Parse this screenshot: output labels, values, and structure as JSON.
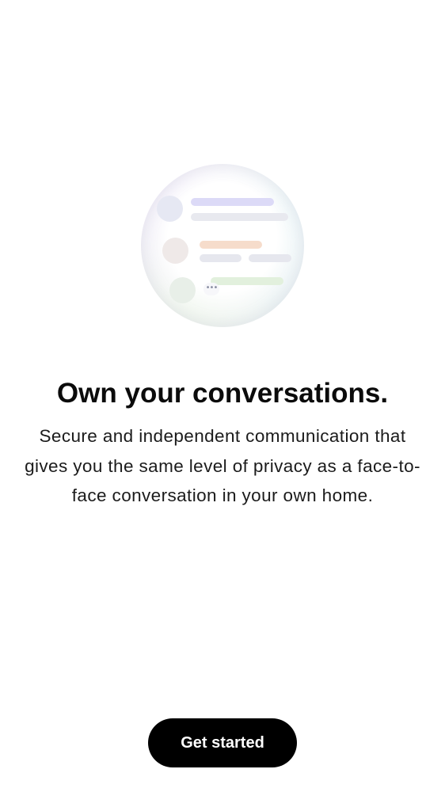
{
  "onboarding": {
    "illustration": {
      "name": "chat-illustration",
      "typing_indicator": "•••",
      "colors": {
        "avatar_1": "#e6e8f3",
        "line_purple": "#dcdaf7",
        "line_orange": "#f6dccb",
        "line_green": "#e2f0dd",
        "line_gray": "#e8e9ef"
      }
    },
    "title": "Own your conversations.",
    "description": "Secure and independent communication that gives you the same level of privacy as a face-to-face conversation in your own home.",
    "cta_label": "Get started",
    "colors": {
      "background": "#ffffff",
      "primary_button": "#000000",
      "primary_button_text": "#ffffff",
      "text": "#111111"
    }
  }
}
